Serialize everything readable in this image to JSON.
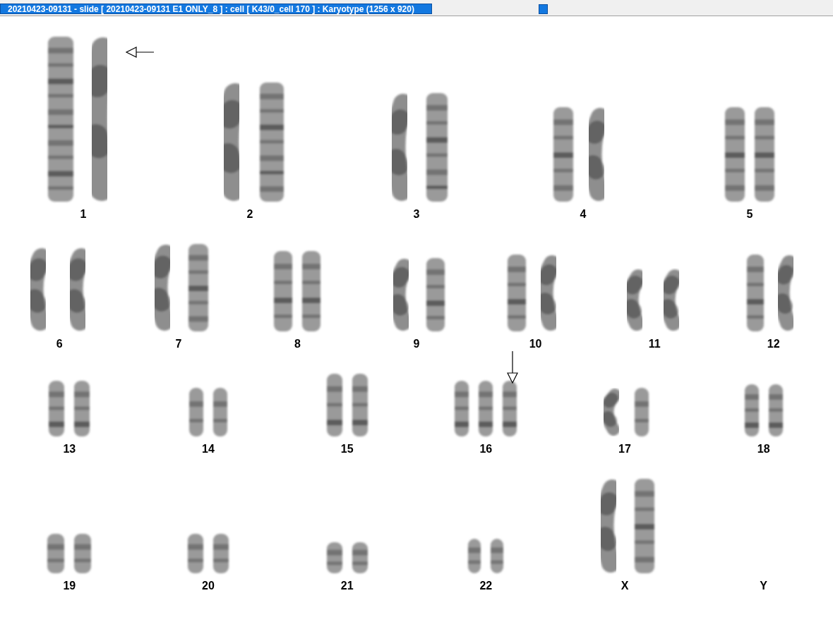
{
  "window": {
    "title": "20210423-09131 - slide [ 20210423-09131 E1 ONLY_8 ] : cell [ K43/0_cell 170 ] : Karyotype  (1256 x 920)"
  },
  "karyotype": {
    "rows": [
      {
        "groups": [
          {
            "label": "1",
            "chromosomes": [
              {
                "kind": "straight"
              },
              {
                "kind": "bent"
              }
            ],
            "marker": {
              "kind": "left-arrow"
            }
          },
          {
            "label": "2",
            "chromosomes": [
              {
                "kind": "bent"
              },
              {
                "kind": "straight"
              }
            ]
          },
          {
            "label": "3",
            "chromosomes": [
              {
                "kind": "bent"
              },
              {
                "kind": "straight"
              }
            ]
          },
          {
            "label": "4",
            "chromosomes": [
              {
                "kind": "straight"
              },
              {
                "kind": "bent"
              }
            ]
          },
          {
            "label": "5",
            "chromosomes": [
              {
                "kind": "straight"
              },
              {
                "kind": "straight"
              }
            ]
          }
        ]
      },
      {
        "groups": [
          {
            "label": "6",
            "chromosomes": [
              {
                "kind": "bent"
              },
              {
                "kind": "bent"
              }
            ]
          },
          {
            "label": "7",
            "chromosomes": [
              {
                "kind": "bent"
              },
              {
                "kind": "straight"
              }
            ]
          },
          {
            "label": "8",
            "chromosomes": [
              {
                "kind": "straight"
              },
              {
                "kind": "straight"
              }
            ]
          },
          {
            "label": "9",
            "chromosomes": [
              {
                "kind": "bent"
              },
              {
                "kind": "straight"
              }
            ]
          },
          {
            "label": "10",
            "chromosomes": [
              {
                "kind": "straight"
              },
              {
                "kind": "bent"
              }
            ]
          },
          {
            "label": "11",
            "chromosomes": [
              {
                "kind": "bent"
              },
              {
                "kind": "bent"
              }
            ]
          },
          {
            "label": "12",
            "chromosomes": [
              {
                "kind": "straight"
              },
              {
                "kind": "bent"
              }
            ]
          }
        ]
      },
      {
        "groups": [
          {
            "label": "13",
            "chromosomes": [
              {
                "kind": "straight"
              },
              {
                "kind": "straight"
              }
            ]
          },
          {
            "label": "14",
            "chromosomes": [
              {
                "kind": "straight"
              },
              {
                "kind": "straight"
              }
            ]
          },
          {
            "label": "15",
            "chromosomes": [
              {
                "kind": "straight"
              },
              {
                "kind": "straight"
              }
            ]
          },
          {
            "label": "16",
            "chromosomes": [
              {
                "kind": "straight"
              },
              {
                "kind": "straight"
              },
              {
                "kind": "straight"
              }
            ],
            "marker": {
              "kind": "down-arrow"
            }
          },
          {
            "label": "17",
            "chromosomes": [
              {
                "kind": "bent"
              },
              {
                "kind": "straight"
              }
            ]
          },
          {
            "label": "18",
            "chromosomes": [
              {
                "kind": "straight"
              },
              {
                "kind": "straight"
              }
            ]
          }
        ]
      },
      {
        "groups": [
          {
            "label": "19",
            "chromosomes": [
              {
                "kind": "straight"
              },
              {
                "kind": "straight"
              }
            ]
          },
          {
            "label": "20",
            "chromosomes": [
              {
                "kind": "straight"
              },
              {
                "kind": "straight"
              }
            ]
          },
          {
            "label": "21",
            "chromosomes": [
              {
                "kind": "straight"
              },
              {
                "kind": "straight"
              }
            ]
          },
          {
            "label": "22",
            "chromosomes": [
              {
                "kind": "straight"
              },
              {
                "kind": "straight"
              }
            ]
          },
          {
            "label": "X",
            "chromosomes": [
              {
                "kind": "bent"
              },
              {
                "kind": "straight"
              }
            ]
          },
          {
            "label": "Y"
          }
        ]
      }
    ]
  }
}
